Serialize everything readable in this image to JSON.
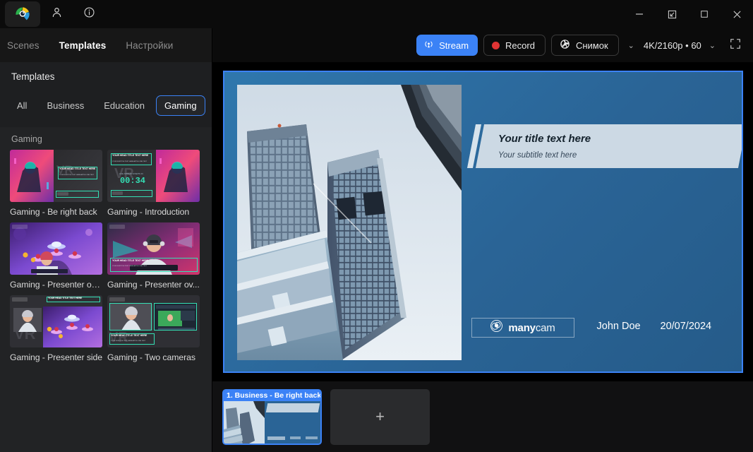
{
  "titlebar": {
    "logo_icon": "manycam-logo-icon",
    "account_icon": "person-icon",
    "info_icon": "info-circle-icon",
    "minimize_label": "—",
    "restore_label": "restore-window",
    "maximize_label": "maximize-window",
    "close_label": "✕"
  },
  "nav": {
    "tabs": [
      {
        "label": "Scenes",
        "active": false
      },
      {
        "label": "Templates",
        "active": true
      },
      {
        "label": "Настройки",
        "active": false
      }
    ]
  },
  "toolbar": {
    "stream_label": "Stream",
    "stream_icon": "broadcast-icon",
    "record_label": "Record",
    "record_icon": "record-dot-icon",
    "snapshot_label": "Снимок",
    "snapshot_icon": "aperture-icon",
    "snapshot_chevron": "⌄",
    "resolution_label": "4K/2160p • 60",
    "resolution_chevron": "⌄",
    "fullscreen_icon": "fullscreen-icon",
    "accent_color": "#3b82f6",
    "record_color": "#e03434"
  },
  "sidebar": {
    "title": "Templates",
    "chips": [
      {
        "label": "All",
        "active": false
      },
      {
        "label": "Business",
        "active": false
      },
      {
        "label": "Education",
        "active": false
      },
      {
        "label": "Gaming",
        "active": true
      }
    ],
    "chip_next_icon": "chevron-right-icon",
    "group_label": "Gaming",
    "templates": [
      {
        "name": "Gaming - Be right back"
      },
      {
        "name": "Gaming - Introduction"
      },
      {
        "name": "Gaming - Presenter on..."
      },
      {
        "name": "Gaming - Presenter ov..."
      },
      {
        "name": "Gaming - Presenter side"
      },
      {
        "name": "Gaming - Two cameras"
      }
    ],
    "thumb_texts": {
      "head_title": "YOUR HEAD TITLE TEXT HERE",
      "sub_title": "YOUR SUBTITLE TEXT HERE APPLE ONE TEXT",
      "stream_starts": "LIVE STREAM STARTS IN",
      "timer": "00:34"
    }
  },
  "canvas": {
    "title_text": "Your title text here",
    "subtitle_text": "Your subtitle text here",
    "logo_bold": "many",
    "logo_light": "cam",
    "logo_icon": "manycam-watermark-icon",
    "presenter_name": "John Doe",
    "date": "20/07/2024",
    "background_color": "#2a6496",
    "selection_color": "#3b82f6",
    "title_box_color": "#ccd9e4"
  },
  "scenebar": {
    "scenes": [
      {
        "label": "1. Business - Be right back",
        "selected": true
      }
    ],
    "add_label": "+",
    "add_icon": "plus-icon"
  }
}
